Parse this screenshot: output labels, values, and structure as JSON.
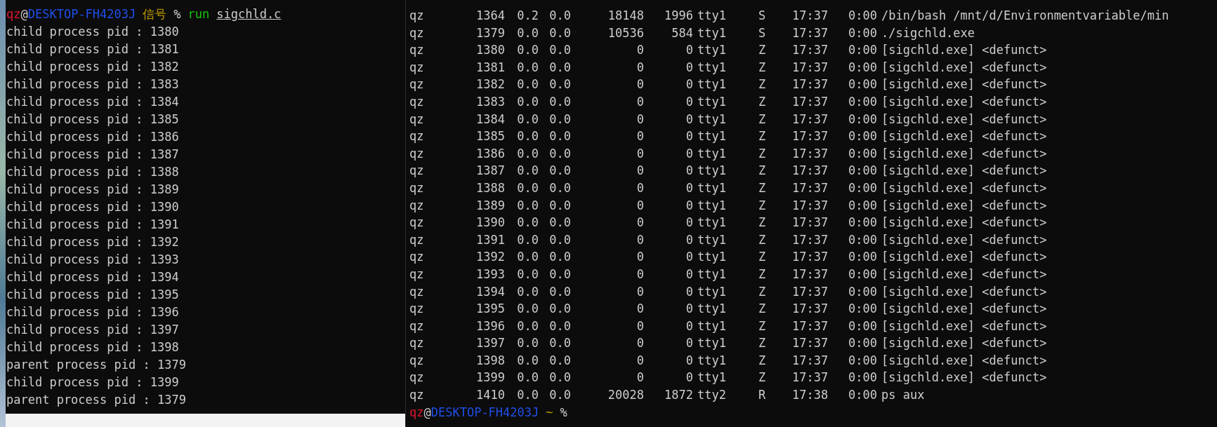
{
  "left_terminal": {
    "prompt": {
      "user": "qz",
      "at": "@",
      "host": "DESKTOP-FH4203J",
      "directory": "信号",
      "symbol": "%",
      "command": "run",
      "argument": "sigchld.c"
    },
    "lines": [
      "child process pid : 1380",
      "child process pid : 1381",
      "child process pid : 1382",
      "child process pid : 1383",
      "child process pid : 1384",
      "child process pid : 1385",
      "child process pid : 1386",
      "child process pid : 1387",
      "child process pid : 1388",
      "child process pid : 1389",
      "child process pid : 1390",
      "child process pid : 1391",
      "child process pid : 1392",
      "child process pid : 1393",
      "child process pid : 1394",
      "child process pid : 1395",
      "child process pid : 1396",
      "child process pid : 1397",
      "child process pid : 1398",
      "parent process pid : 1379",
      "child process pid : 1399",
      "parent process pid : 1379"
    ]
  },
  "right_terminal": {
    "rows": [
      [
        "qz",
        "1364",
        "0.2",
        "0.0",
        "18148",
        "1996",
        "tty1",
        "S",
        "17:37",
        "0:00",
        "/bin/bash /mnt/d/Environmentvariable/min"
      ],
      [
        "qz",
        "1379",
        "0.0",
        "0.0",
        "10536",
        "584",
        "tty1",
        "S",
        "17:37",
        "0:00",
        "./sigchld.exe"
      ],
      [
        "qz",
        "1380",
        "0.0",
        "0.0",
        "0",
        "0",
        "tty1",
        "Z",
        "17:37",
        "0:00",
        "[sigchld.exe] <defunct>"
      ],
      [
        "qz",
        "1381",
        "0.0",
        "0.0",
        "0",
        "0",
        "tty1",
        "Z",
        "17:37",
        "0:00",
        "[sigchld.exe] <defunct>"
      ],
      [
        "qz",
        "1382",
        "0.0",
        "0.0",
        "0",
        "0",
        "tty1",
        "Z",
        "17:37",
        "0:00",
        "[sigchld.exe] <defunct>"
      ],
      [
        "qz",
        "1383",
        "0.0",
        "0.0",
        "0",
        "0",
        "tty1",
        "Z",
        "17:37",
        "0:00",
        "[sigchld.exe] <defunct>"
      ],
      [
        "qz",
        "1384",
        "0.0",
        "0.0",
        "0",
        "0",
        "tty1",
        "Z",
        "17:37",
        "0:00",
        "[sigchld.exe] <defunct>"
      ],
      [
        "qz",
        "1385",
        "0.0",
        "0.0",
        "0",
        "0",
        "tty1",
        "Z",
        "17:37",
        "0:00",
        "[sigchld.exe] <defunct>"
      ],
      [
        "qz",
        "1386",
        "0.0",
        "0.0",
        "0",
        "0",
        "tty1",
        "Z",
        "17:37",
        "0:00",
        "[sigchld.exe] <defunct>"
      ],
      [
        "qz",
        "1387",
        "0.0",
        "0.0",
        "0",
        "0",
        "tty1",
        "Z",
        "17:37",
        "0:00",
        "[sigchld.exe] <defunct>"
      ],
      [
        "qz",
        "1388",
        "0.0",
        "0.0",
        "0",
        "0",
        "tty1",
        "Z",
        "17:37",
        "0:00",
        "[sigchld.exe] <defunct>"
      ],
      [
        "qz",
        "1389",
        "0.0",
        "0.0",
        "0",
        "0",
        "tty1",
        "Z",
        "17:37",
        "0:00",
        "[sigchld.exe] <defunct>"
      ],
      [
        "qz",
        "1390",
        "0.0",
        "0.0",
        "0",
        "0",
        "tty1",
        "Z",
        "17:37",
        "0:00",
        "[sigchld.exe] <defunct>"
      ],
      [
        "qz",
        "1391",
        "0.0",
        "0.0",
        "0",
        "0",
        "tty1",
        "Z",
        "17:37",
        "0:00",
        "[sigchld.exe] <defunct>"
      ],
      [
        "qz",
        "1392",
        "0.0",
        "0.0",
        "0",
        "0",
        "tty1",
        "Z",
        "17:37",
        "0:00",
        "[sigchld.exe] <defunct>"
      ],
      [
        "qz",
        "1393",
        "0.0",
        "0.0",
        "0",
        "0",
        "tty1",
        "Z",
        "17:37",
        "0:00",
        "[sigchld.exe] <defunct>"
      ],
      [
        "qz",
        "1394",
        "0.0",
        "0.0",
        "0",
        "0",
        "tty1",
        "Z",
        "17:37",
        "0:00",
        "[sigchld.exe] <defunct>"
      ],
      [
        "qz",
        "1395",
        "0.0",
        "0.0",
        "0",
        "0",
        "tty1",
        "Z",
        "17:37",
        "0:00",
        "[sigchld.exe] <defunct>"
      ],
      [
        "qz",
        "1396",
        "0.0",
        "0.0",
        "0",
        "0",
        "tty1",
        "Z",
        "17:37",
        "0:00",
        "[sigchld.exe] <defunct>"
      ],
      [
        "qz",
        "1397",
        "0.0",
        "0.0",
        "0",
        "0",
        "tty1",
        "Z",
        "17:37",
        "0:00",
        "[sigchld.exe] <defunct>"
      ],
      [
        "qz",
        "1398",
        "0.0",
        "0.0",
        "0",
        "0",
        "tty1",
        "Z",
        "17:37",
        "0:00",
        "[sigchld.exe] <defunct>"
      ],
      [
        "qz",
        "1399",
        "0.0",
        "0.0",
        "0",
        "0",
        "tty1",
        "Z",
        "17:37",
        "0:00",
        "[sigchld.exe] <defunct>"
      ],
      [
        "qz",
        "1410",
        "0.0",
        "0.0",
        "20028",
        "1872",
        "tty2",
        "R",
        "17:38",
        "0:00",
        "ps aux"
      ]
    ],
    "prompt": {
      "user": "qz",
      "at": "@",
      "host": "DESKTOP-FH4203J",
      "directory": "~",
      "symbol": "%"
    }
  }
}
